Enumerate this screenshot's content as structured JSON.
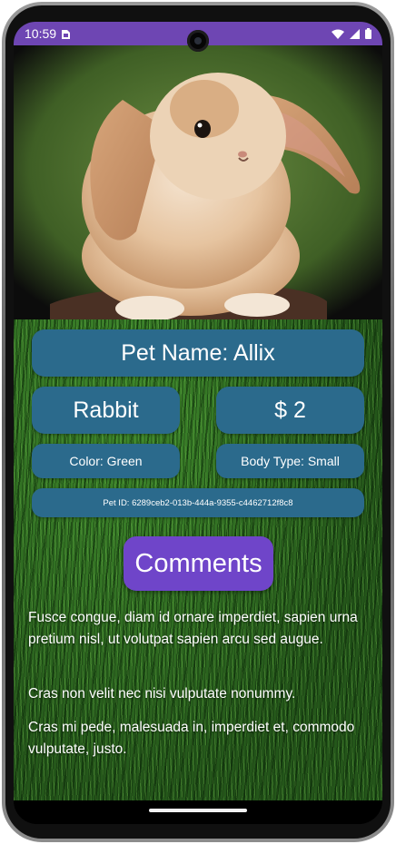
{
  "status_bar": {
    "time": "10:59",
    "icons": [
      "sim-card-icon",
      "wifi-icon",
      "cell-signal-icon",
      "battery-icon"
    ]
  },
  "pet": {
    "photo_icon": "rabbit-photo",
    "name_label": "Pet Name: Allix",
    "species": "Rabbit",
    "price": "$ 2",
    "color_label": "Color: Green",
    "body_type_label": "Body Type: Small",
    "id_label": "Pet ID: 6289ceb2-013b-444a-9355-c4462712f8c8"
  },
  "comments": {
    "button_label": "Comments",
    "items": [
      "Fusce congue, diam id ornare imperdiet, sapien urna pretium nisl, ut volutpat sapien arcu sed augue.",
      "Cras non velit nec nisi vulputate nonummy.",
      "Cras mi pede, malesuada in, imperdiet et, commodo vulputate, justo."
    ]
  },
  "colors": {
    "status_bar": "#6e46b3",
    "card": "#2b6a8c",
    "button": "#6f45c9",
    "grass": "#2d6a22"
  }
}
